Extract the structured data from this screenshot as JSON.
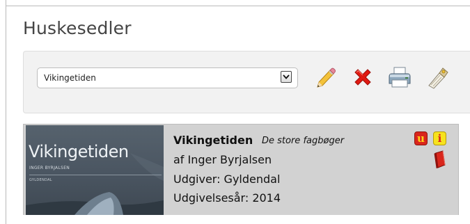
{
  "page": {
    "title": "Huskesedler"
  },
  "toolbar": {
    "selected_list": "Vikingetiden",
    "actions": [
      {
        "icon": "pencil-icon",
        "action": "edit"
      },
      {
        "icon": "red-x-icon",
        "action": "delete"
      },
      {
        "icon": "printer-icon",
        "action": "print"
      },
      {
        "icon": "send-icon",
        "action": "send"
      }
    ]
  },
  "result": {
    "cover": {
      "title": "Vikingetiden",
      "author": "INGER BYRJALSEN",
      "publisher": "GYLDENDAL"
    },
    "title": "Vikingetiden",
    "series": "De store fagbøger",
    "author_line": "af Inger Byrjalsen",
    "publisher_line": "Udgiver: Gyldendal",
    "year_line": "Udgivelsesår: 2014",
    "badges": {
      "u": "u",
      "i": "i"
    },
    "colors": {
      "badge_u_bg": "#d9261c",
      "badge_i_bg": "#f7e21e",
      "card_bg": "#d2d2d2"
    }
  }
}
